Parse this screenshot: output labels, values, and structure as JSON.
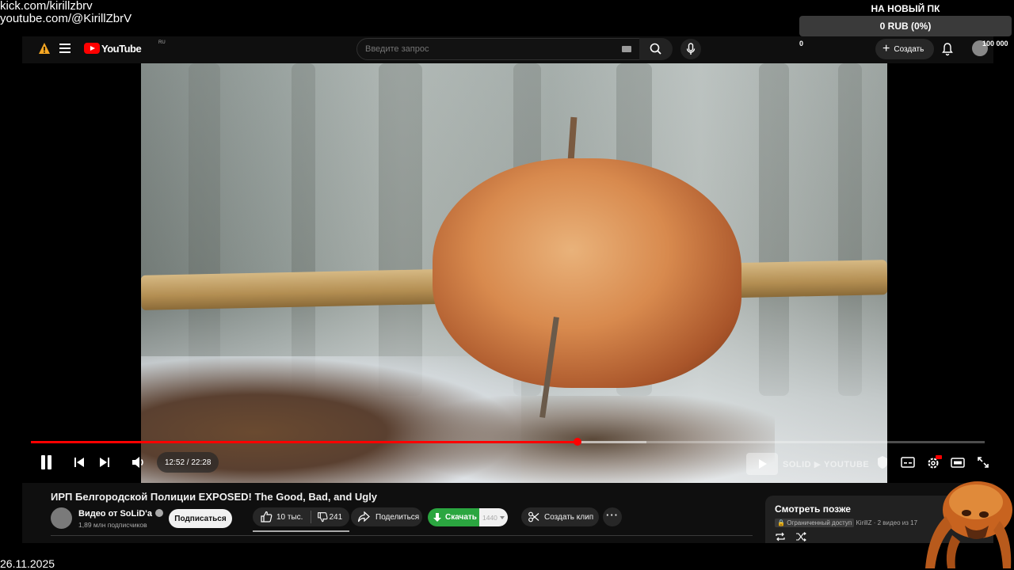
{
  "overlay": {
    "line1": "kick.com/kirillzbrv",
    "line2": "youtube.com/@KirillZbrV",
    "goal_title": "НА НОВЫЙ ПК",
    "goal_progress_text": "0 RUB (0%)",
    "goal_progress_fraction": 0,
    "goal_min": "0",
    "goal_max": "100 000",
    "date": "26.11.2025"
  },
  "topbar": {
    "logo_text": "YouTube",
    "logo_region": "RU",
    "search_placeholder": "Введите запрос",
    "create_label": "Создать"
  },
  "player": {
    "time": "12:52 / 22:28",
    "progress_fraction": 0.573,
    "buffer_fraction": 0.645,
    "watermark": "SOLID ▶ YOUTUBE",
    "accent_color": "#ff0000"
  },
  "video": {
    "title": "ИРП Белгородской Полиции EXPOSED! The Good, Bad, and Ugly",
    "channel_name": "Видео от SoLiD'a",
    "subscribers": "1,89 млн подписчиков",
    "subscribe_label": "Подписаться",
    "likes": "10 тыс.",
    "dislikes": "241",
    "share_label": "Поделиться",
    "download_label": "Скачать",
    "download_quality": "1440",
    "clip_label": "Создать клип"
  },
  "watch_later": {
    "title": "Смотреть позже",
    "badge": "Ограниченный доступ",
    "meta": "KirillZ · 2 видео из 17"
  }
}
